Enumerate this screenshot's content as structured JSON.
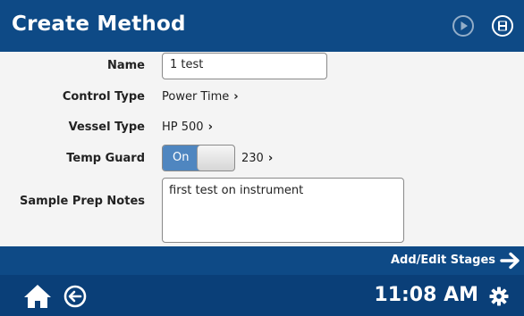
{
  "header": {
    "title": "Create Method",
    "play_icon": "play-icon",
    "save_icon": "save-icon"
  },
  "form": {
    "name": {
      "label": "Name",
      "value": "1 test"
    },
    "control_type": {
      "label": "Control Type",
      "value": "Power Time"
    },
    "vessel_type": {
      "label": "Vessel Type",
      "value": "HP 500"
    },
    "temp_guard": {
      "label": "Temp Guard",
      "toggle_label": "On",
      "toggle_state": true,
      "value": "230"
    },
    "sample_prep_notes": {
      "label": "Sample Prep Notes",
      "value": "first test on instrument"
    }
  },
  "action_bar": {
    "label": "Add/Edit Stages",
    "icon": "arrow-right-icon"
  },
  "footer": {
    "home_icon": "home-icon",
    "back_icon": "back-icon",
    "time": "11:08 AM",
    "settings_icon": "gear-icon"
  },
  "colors": {
    "header_bg": "#0e4a86",
    "footer_bg": "#0a3f78",
    "toggle_on": "#4f86c0",
    "form_bg": "#f4f4f4"
  }
}
